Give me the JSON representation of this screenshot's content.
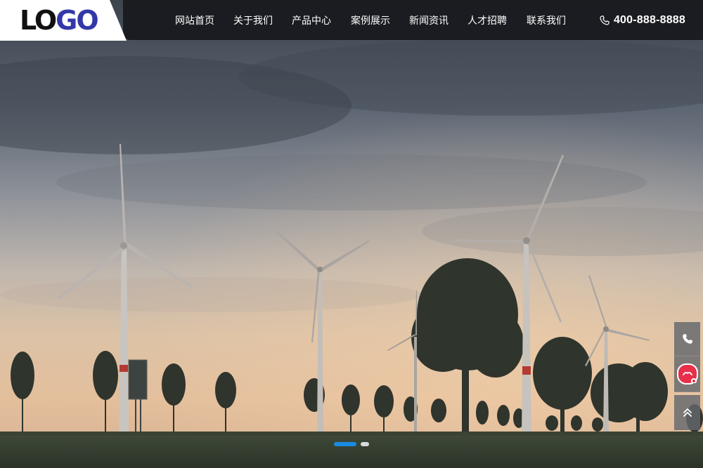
{
  "logo": {
    "text_lo": "LO",
    "text_go": "GO"
  },
  "nav": {
    "items": [
      {
        "label": "网站首页"
      },
      {
        "label": "关于我们"
      },
      {
        "label": "产品中心"
      },
      {
        "label": "案例展示"
      },
      {
        "label": "新闻资讯"
      },
      {
        "label": "人才招聘"
      },
      {
        "label": "联系我们"
      }
    ],
    "phone": "400-888-8888"
  },
  "slider": {
    "slide_count": 2,
    "active_slide": 1
  },
  "icons": {
    "phone": "phone-icon",
    "side_phone": "phone-icon",
    "side_chat": "chat-icon",
    "side_top": "double-chevron-up-icon"
  },
  "colors": {
    "navbar_bg": "#1a1c20",
    "logo_accent": "#3338a8",
    "dot_active": "#1a8ae0",
    "chat_badge": "#e8304a"
  }
}
